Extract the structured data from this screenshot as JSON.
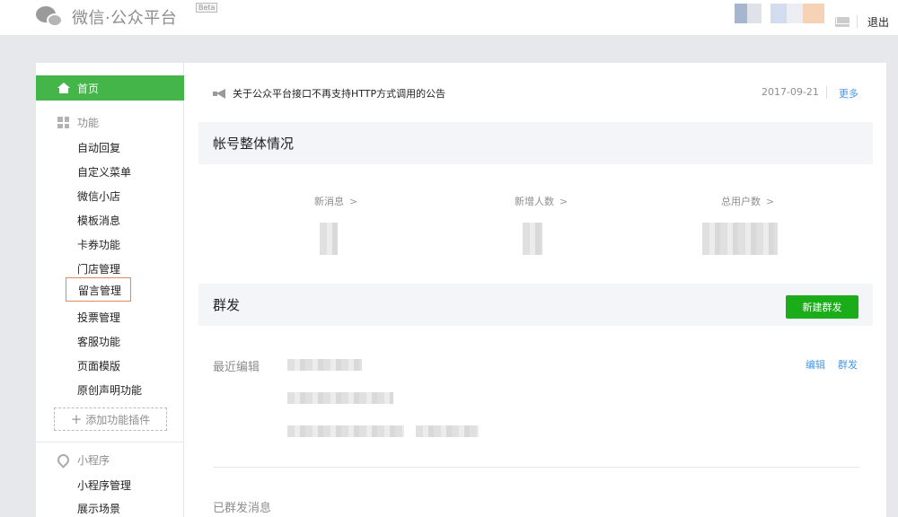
{
  "header": {
    "logo_text": "微信·公众平台",
    "beta": "Beta",
    "logout": "退出"
  },
  "sidebar": {
    "home": "首页",
    "features_title": "功能",
    "feature_items": [
      "自动回复",
      "自定义菜单",
      "微信小店",
      "模板消息",
      "卡券功能",
      "门店管理",
      "留言管理",
      "投票管理",
      "客服功能",
      "页面模版",
      "原创声明功能"
    ],
    "add_plugin": "添加功能插件",
    "mini_program_title": "小程序",
    "mini_program_items": [
      "小程序管理",
      "展示场景"
    ]
  },
  "announcement": {
    "text": "关于公众平台接口不再支持HTTP方式调用的公告",
    "date": "2017-09-21",
    "more": "更多"
  },
  "account_overview": {
    "title": "帐号整体情况",
    "stats": [
      {
        "label": "新消息"
      },
      {
        "label": "新增人数"
      },
      {
        "label": "总用户数"
      }
    ]
  },
  "mass_send": {
    "title": "群发",
    "new_button": "新建群发",
    "recent_label": "最近编辑",
    "edit": "编辑",
    "send": "群发",
    "sent_label": "已群发消息"
  },
  "colors": {
    "brand_green": "#44b549",
    "button_green": "#1aad19",
    "link_blue": "#459ae9",
    "highlight_border": "#e3885c"
  }
}
